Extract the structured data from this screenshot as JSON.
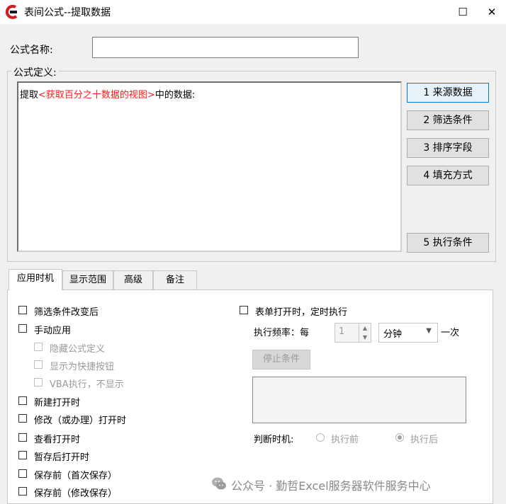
{
  "window": {
    "title": "表间公式--提取数据",
    "maximize_icon": "☐",
    "close_icon": "✕"
  },
  "formula_name": {
    "label": "公式名称:",
    "value": ""
  },
  "formula_definition": {
    "legend": "公式定义:",
    "text_prefix": "提取",
    "text_source": "<获取百分之十数据的视图>",
    "text_suffix": "中的数据:"
  },
  "side_buttons": {
    "source": "1 来源数据",
    "filter": "2 筛选条件",
    "sort": "3 排序字段",
    "fill": "4 填充方式",
    "exec": "5 执行条件"
  },
  "tabs": [
    "应用时机",
    "显示范围",
    "高级",
    "备注"
  ],
  "left_options": {
    "filter_changed": "筛选条件改变后",
    "manual": "手动应用",
    "hide_formula": "隐藏公式定义",
    "show_shortcut": "显示为快捷按钮",
    "vba_exec": "VBA执行，不显示",
    "new_open": "新建打开时",
    "modify_open": "修改（或办理）打开时",
    "view_open": "查看打开时",
    "draft_open": "暂存后打开时",
    "before_save_first": "保存前（首次保存）",
    "before_save_modify": "保存前（修改保存）"
  },
  "right_options": {
    "timed_exec": "表单打开时，定时执行",
    "freq_label": "执行频率：每",
    "freq_value": "1",
    "unit": "分钟",
    "freq_suffix": "一次",
    "stop_button": "停止条件",
    "judge_label": "判断时机:",
    "before_exec": "执行前",
    "after_exec": "执行后"
  },
  "watermark": {
    "text": "公众号 · 勤哲Excel服务器软件服务中心"
  },
  "colors": {
    "accent": "#0078d7",
    "red_text": "#ff1a1a"
  }
}
